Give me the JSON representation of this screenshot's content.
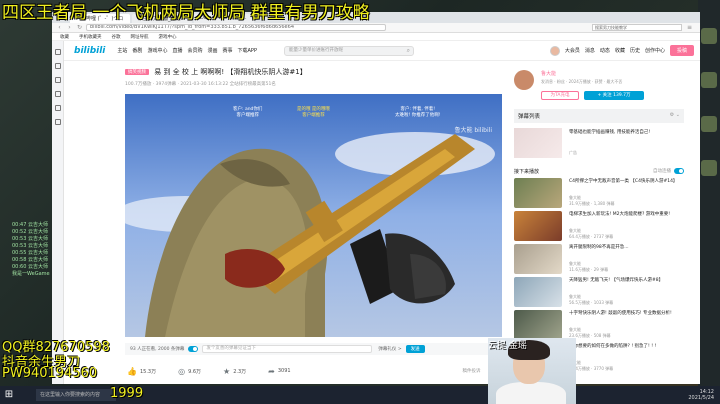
{
  "overlay": {
    "banner": "四区王者局  一个飞机两局大师局 群里有男刀攻略",
    "qq": "QQ群827670598",
    "douyin": "抖音余生男刀",
    "pw": "PW940194560",
    "number": "1999",
    "webcam_label": "云提      金瑶"
  },
  "browser": {
    "tabs": [
      "哔哩哔哩 (゜-゜)つロ",
      "余生男刀直播_英雄...",
      "Douyu Yusheng0..."
    ],
    "address": "bilibili.com/video/BV1KwiKJ11T7/?spm_id_from=333.851.b_7265636f6d6d656e64",
    "search_placeholder": "搜索男刀技能教学",
    "bookmarks": [
      "收藏",
      "手机收藏夹",
      "谷歌",
      "网址导航",
      "游戏中心"
    ]
  },
  "site": {
    "logo": "bilibili",
    "nav": [
      "主站",
      "番剧",
      "游戏中心",
      "直播",
      "会员购",
      "漫画",
      "赛事",
      "下载APP"
    ],
    "search_placeholder": "能量少量单价进账行开放呢",
    "header_right": [
      "大会员",
      "消息",
      "动态",
      "收藏",
      "历史",
      "创作中心"
    ],
    "upload": "投稿"
  },
  "video": {
    "tag": "搞笑视频",
    "title": "易 到 全 校 上 啊啊啊! 【滑翔机快乐阴人游#1】",
    "meta": "100.7万播放 · 3974弹幕 · 2021-03-30 16:13:22 全站排行榜最高第51名",
    "subtitle_left": "客户: and你们\n客户端推荐",
    "subtitle_mid": "是的哦 是的哦哦\n客户端推荐",
    "subtitle_right": "客户: 伴着, 伴着!\n太难啦! 你推荐了他啊!",
    "watermark": "鲁大能 bilibili"
  },
  "controls": {
    "viewers": "93 人正在看, 2000 条弹幕",
    "danmaku_placeholder": "发个友善的弹幕见证当下",
    "etiquette": "弹幕礼仪 >",
    "send": "发送"
  },
  "actions": {
    "like": "15.3万",
    "coin": "9.6万",
    "favorite": "2.3万",
    "share": "3091",
    "report": "稿件投诉",
    "notes": "记笔记"
  },
  "up": {
    "name": "鲁大能",
    "desc": "发消息 · 粉丝 · 2024万播放 · 获赞 · 最大不丢",
    "charge": "为TA充电",
    "follow": "+ 关注 139.7万"
  },
  "danmaku_list": {
    "label": "弹幕列表",
    "icons": "⚙ ⌄"
  },
  "ad": {
    "title": "零基础也能学插画赚钱, 用技能养活自己!",
    "label": "广告"
  },
  "next": {
    "heading": "接下来播放",
    "autoplay": "自动连播"
  },
  "recommendations": [
    {
      "title": "C4所撑之学中无敌声音第一类 【C4快乐阴人游#14】",
      "up": "鲁大能",
      "stats": "31.9万播放 · 1,380 弹幕"
    },
    {
      "title": "电梯求生加入新玩法! M2大炮能爬楼? 游戏中重要!",
      "up": "鲁大能",
      "stats": "64.4万播放 · 2737 弹幕"
    },
    {
      "title": "离开腿限制的98不再是开急...",
      "up": "鲁大能",
      "stats": "11.6万播放 · 29 弹幕"
    },
    {
      "title": "天降猛男! 无敌飞天! 【气场爆炸快乐人游#8】",
      "up": "鲁大能",
      "stats": "56.5万播放 · 1033 弹幕"
    },
    {
      "title": "十字弩快乐阴人游! 敲敲的使用技巧! 专业数据分析!",
      "up": "鲁大能",
      "stats": "23.6万播放 · 508 弹幕"
    },
    {
      "title": "是你想要的如何在多做的陷阱? ! 别急了! ! !",
      "up": "鲁大能",
      "stats": "44.4万播放 · 3770 弹幕"
    }
  ],
  "taskbar": {
    "search": "在这里输入你要搜索的内容",
    "time": "14:12",
    "date": "2021/5/24"
  },
  "chat": [
    "00:47 云吉大师",
    "00:52 云吉大师",
    "00:53 云吉大师",
    "00:53 云吉大师",
    "00:55 云吉大师",
    "00:58 云吉大师",
    "00:60 云吉大师",
    "我是一WeGame"
  ]
}
